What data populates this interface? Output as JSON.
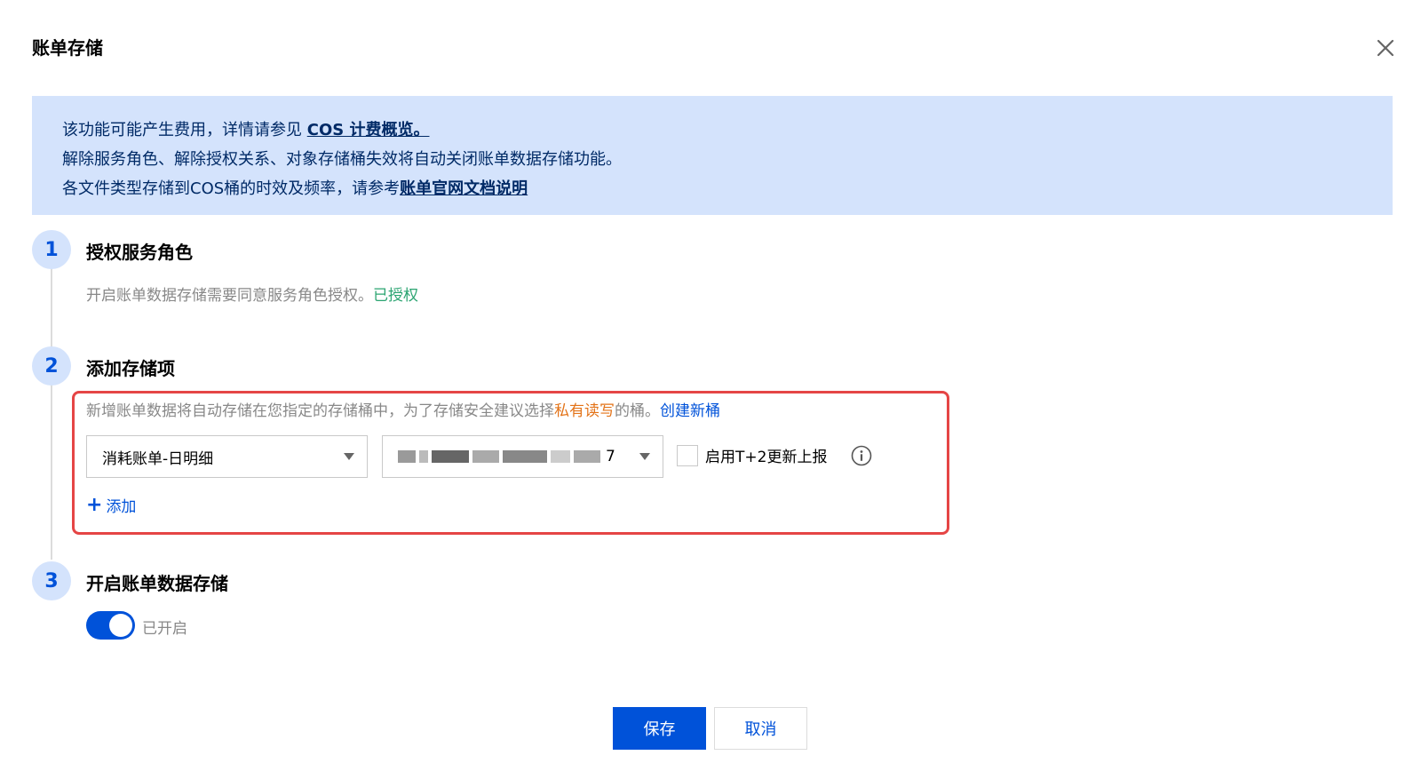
{
  "dialog": {
    "title": "账单存储",
    "close_icon": "close-icon"
  },
  "notice": {
    "line1_text": "该功能可能产生费用，详情请参见 ",
    "line1_link": "COS 计费概览。",
    "line2_text": "解除服务角色、解除授权关系、对象存储桶失效将自动关闭账单数据存储功能。",
    "line3_text": "各文件类型存储到COS桶的时效及频率，请参考",
    "line3_link": "账单官网文档说明"
  },
  "steps": [
    {
      "num": "1",
      "title": "授权服务角色",
      "desc": "开启账单数据存储需要同意服务角色授权。",
      "status": "已授权"
    },
    {
      "num": "2",
      "title": "添加存储项"
    },
    {
      "num": "3",
      "title": "开启账单数据存储"
    }
  ],
  "storage": {
    "hint_prefix": "新增账单数据将自动存储在您指定的存储桶中，为了存储安全建议选择",
    "hint_warn": "私有读写",
    "hint_suffix": "的桶。",
    "create_link": "创建新桶",
    "bill_type_select": "消耗账单-日明细",
    "bucket_select_suffix": "7",
    "checkbox_label": "启用T+2更新上报",
    "add_label": "添加"
  },
  "switch": {
    "state_label": "已开启",
    "enabled": true
  },
  "footer": {
    "save_label": "保存",
    "cancel_label": "取消"
  },
  "colors": {
    "primary": "#0052d9",
    "notice_bg": "#d4e3fc",
    "success": "#2ba471",
    "warning": "#e37318",
    "highlight": "#e54545"
  }
}
